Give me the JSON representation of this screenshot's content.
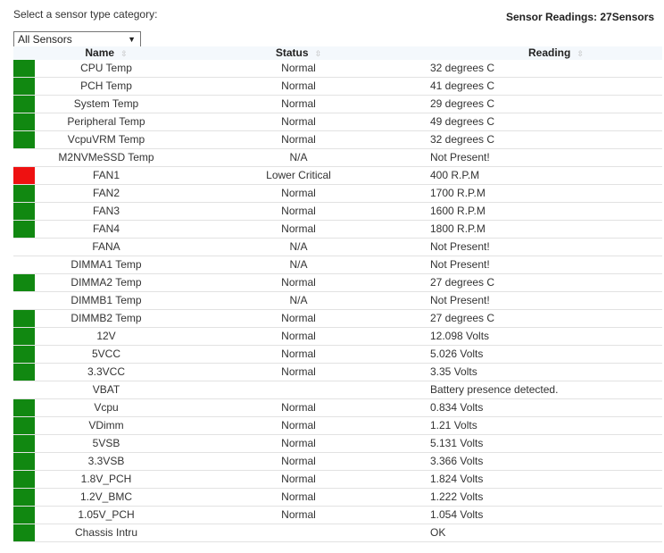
{
  "header": {
    "category_label": "Select a sensor type category:",
    "readings_label": "Sensor Readings:",
    "readings_count": "27",
    "readings_suffix": "Sensors"
  },
  "category_select": {
    "selected": "All Sensors"
  },
  "colors": {
    "normal": "#118811",
    "critical": "#ee1111",
    "none": "transparent"
  },
  "table": {
    "columns": [
      "Name",
      "Status",
      "Reading"
    ],
    "rows": [
      {
        "name": "CPU Temp",
        "status": "Normal",
        "reading": "32 degrees C",
        "indicator": "normal"
      },
      {
        "name": "PCH Temp",
        "status": "Normal",
        "reading": "41 degrees C",
        "indicator": "normal"
      },
      {
        "name": "System Temp",
        "status": "Normal",
        "reading": "29 degrees C",
        "indicator": "normal"
      },
      {
        "name": "Peripheral Temp",
        "status": "Normal",
        "reading": "49 degrees C",
        "indicator": "normal"
      },
      {
        "name": "VcpuVRM Temp",
        "status": "Normal",
        "reading": "32 degrees C",
        "indicator": "normal"
      },
      {
        "name": "M2NVMeSSD Temp",
        "status": "N/A",
        "reading": "Not Present!",
        "indicator": "none"
      },
      {
        "name": "FAN1",
        "status": "Lower Critical",
        "reading": "400 R.P.M",
        "indicator": "critical"
      },
      {
        "name": "FAN2",
        "status": "Normal",
        "reading": "1700 R.P.M",
        "indicator": "normal"
      },
      {
        "name": "FAN3",
        "status": "Normal",
        "reading": "1600 R.P.M",
        "indicator": "normal"
      },
      {
        "name": "FAN4",
        "status": "Normal",
        "reading": "1800 R.P.M",
        "indicator": "normal"
      },
      {
        "name": "FANA",
        "status": "N/A",
        "reading": "Not Present!",
        "indicator": "none"
      },
      {
        "name": "DIMMA1 Temp",
        "status": "N/A",
        "reading": "Not Present!",
        "indicator": "none"
      },
      {
        "name": "DIMMA2 Temp",
        "status": "Normal",
        "reading": "27 degrees C",
        "indicator": "normal"
      },
      {
        "name": "DIMMB1 Temp",
        "status": "N/A",
        "reading": "Not Present!",
        "indicator": "none"
      },
      {
        "name": "DIMMB2 Temp",
        "status": "Normal",
        "reading": "27 degrees C",
        "indicator": "normal"
      },
      {
        "name": "12V",
        "status": "Normal",
        "reading": "12.098 Volts",
        "indicator": "normal"
      },
      {
        "name": "5VCC",
        "status": "Normal",
        "reading": "5.026 Volts",
        "indicator": "normal"
      },
      {
        "name": "3.3VCC",
        "status": "Normal",
        "reading": "3.35 Volts",
        "indicator": "normal"
      },
      {
        "name": "VBAT",
        "status": "",
        "reading": "Battery presence detected.",
        "indicator": "none"
      },
      {
        "name": "Vcpu",
        "status": "Normal",
        "reading": "0.834 Volts",
        "indicator": "normal"
      },
      {
        "name": "VDimm",
        "status": "Normal",
        "reading": "1.21 Volts",
        "indicator": "normal"
      },
      {
        "name": "5VSB",
        "status": "Normal",
        "reading": "5.131 Volts",
        "indicator": "normal"
      },
      {
        "name": "3.3VSB",
        "status": "Normal",
        "reading": "3.366 Volts",
        "indicator": "normal"
      },
      {
        "name": "1.8V_PCH",
        "status": "Normal",
        "reading": "1.824 Volts",
        "indicator": "normal"
      },
      {
        "name": "1.2V_BMC",
        "status": "Normal",
        "reading": "1.222 Volts",
        "indicator": "normal"
      },
      {
        "name": "1.05V_PCH",
        "status": "Normal",
        "reading": "1.054 Volts",
        "indicator": "normal"
      },
      {
        "name": "Chassis Intru",
        "status": "",
        "reading": "OK",
        "indicator": "normal"
      }
    ]
  }
}
